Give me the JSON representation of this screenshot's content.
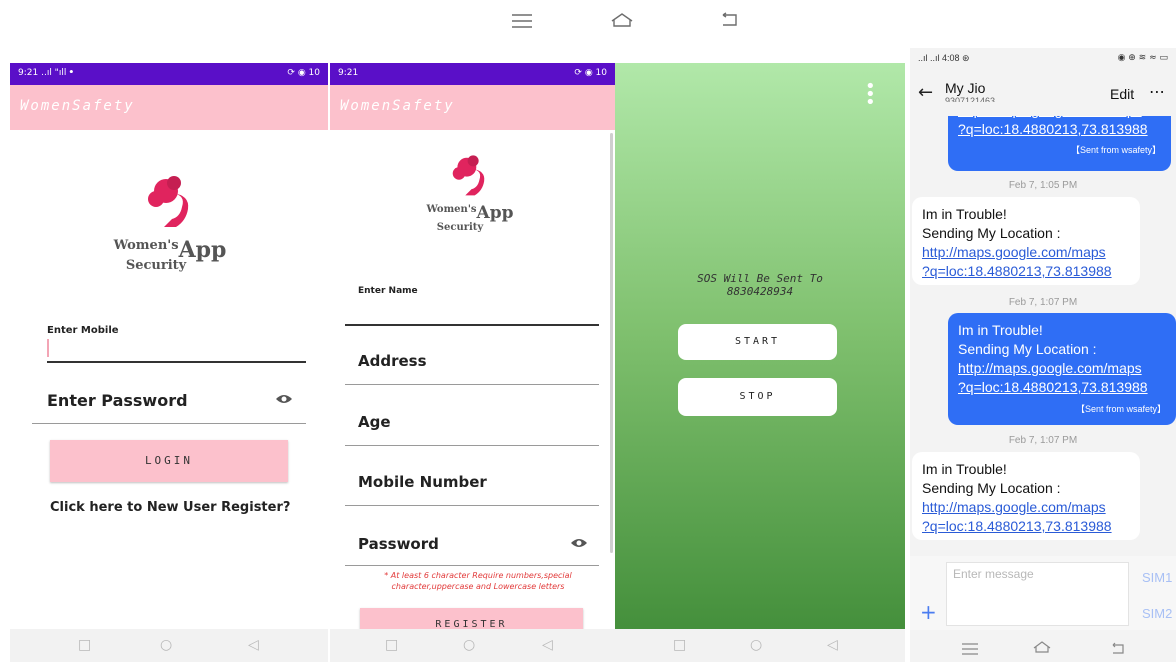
{
  "system_nav": {
    "menu_icon": "menu-icon",
    "home_icon": "home-icon",
    "back_icon": "back-icon"
  },
  "screen1": {
    "status_time": "9:21",
    "status_left_icons": "..ıl \"ıll ꔷ",
    "status_right": "⟳ ◉ 10",
    "app_title": "WomenSafety",
    "logo_line1": "Women's",
    "logo_line2": "Security",
    "logo_app": "App",
    "mobile_label": "Enter Mobile",
    "password_label": "Enter Password",
    "login_button": "LOGIN",
    "register_link": "Click here to New User Register?"
  },
  "screen2": {
    "status_time": "9:21",
    "status_right": "⟳ ◉ 10",
    "app_title": "WomenSafety",
    "logo_line1": "Women's",
    "logo_line2": "Security",
    "logo_app": "App",
    "name_label": "Enter Name",
    "address_label": "Address",
    "age_label": "Age",
    "mobile_label": "Mobile Number",
    "password_label": "Password",
    "password_hint_1": "* At least 6 character Require numbers,special",
    "password_hint_2": "character,uppercase and Lowercase letters",
    "register_button": "REGISTER"
  },
  "screen3": {
    "sos_line1": "SOS Will Be Sent To",
    "sos_line2": "8830428934",
    "start_button": "START",
    "stop_button": "STOP"
  },
  "screen4": {
    "status_time": "4:08",
    "contact_name": "My Jio",
    "contact_number": "9307121463",
    "edit_label": "Edit",
    "more_icon": "⋯",
    "top_partial_link_1": "http://maps.google.com/maps",
    "top_partial_link_2": "?q=loc:18.4880213,73.813988",
    "top_sent_from": "【Sent from wsafety】",
    "stamp_1": "Feb 7, 1:05 PM",
    "msg1_line1": "Im in Trouble!",
    "msg1_line2": "Sending My Location :",
    "msg1_link1": "http://maps.google.com/maps",
    "msg1_link2": "?q=loc:18.4880213,73.813988",
    "stamp_2": "Feb 7, 1:07 PM",
    "msg2_line1": "Im in Trouble!",
    "msg2_line2": "Sending My Location :",
    "msg2_link1": "http://maps.google.com/maps",
    "msg2_link2": "?q=loc:18.4880213,73.813988",
    "msg2_sent_from": "【Sent from wsafety】",
    "stamp_3": "Feb 7, 1:07 PM",
    "msg3_line1": "Im in Trouble!",
    "msg3_line2": "Sending My Location :",
    "msg3_link1": "http://maps.google.com/maps",
    "msg3_link2": "?q=loc:18.4880213,73.813988",
    "input_placeholder": "Enter message",
    "sim1": "SIM1",
    "sim2": "SIM2"
  },
  "colors": {
    "status_purple": "#5a0fc8",
    "appbar_pink": "#fcc1cc",
    "sent_blue": "#2f6ef5",
    "logo_red": "#e0245e"
  }
}
